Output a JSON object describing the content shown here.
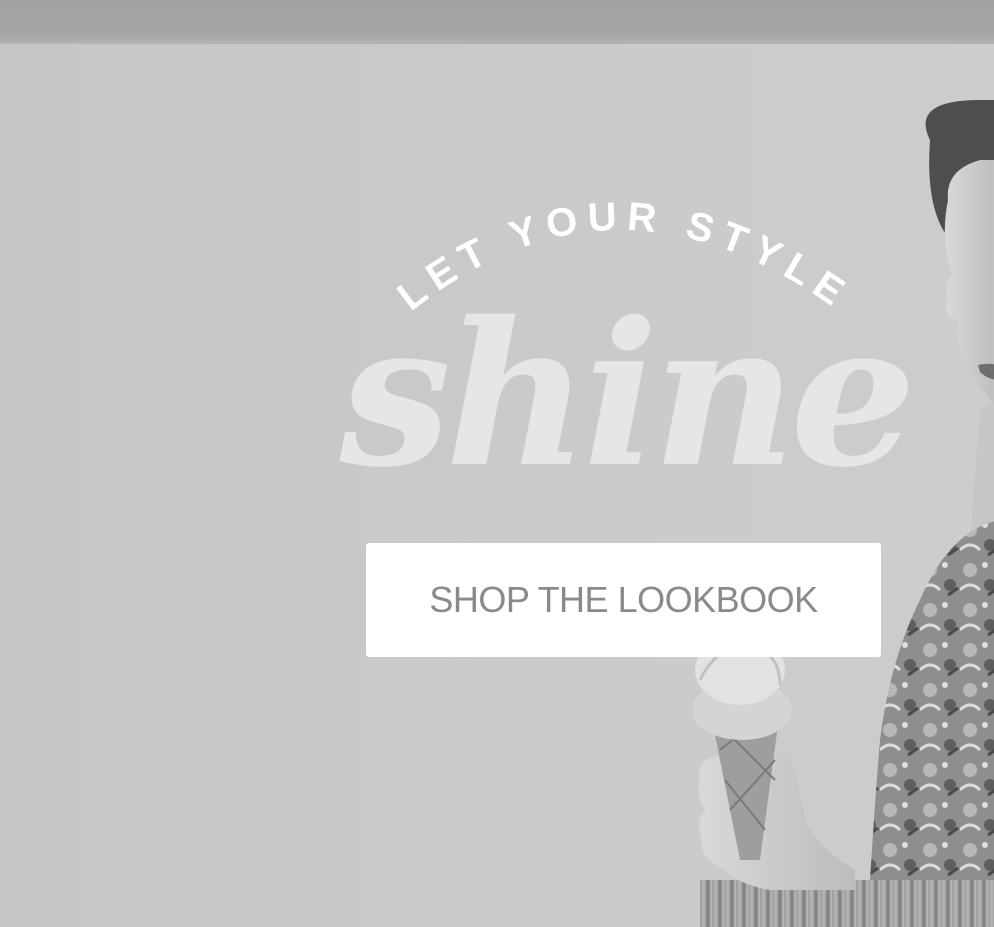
{
  "hero": {
    "tagline": "LET YOUR STYLE",
    "headline": "shine",
    "cta_label": "SHOP THE LOOKBOOK"
  },
  "photo": {
    "subject_icon": "woman-holding-ice-cream-photo"
  },
  "colors": {
    "background": "#c8c8c8",
    "top_bar": "#a4a4a4",
    "headline": "#e6e6e6",
    "cta_background": "#ffffff",
    "cta_text": "#8a8a8a"
  }
}
